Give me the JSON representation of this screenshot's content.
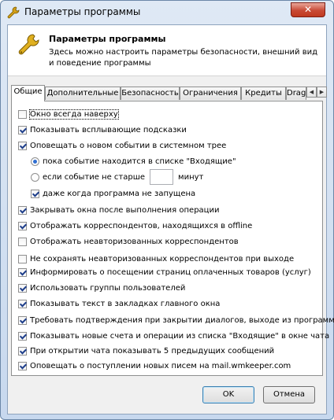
{
  "window": {
    "title": "Параметры программы",
    "close_symbol": "✕"
  },
  "header": {
    "title": "Параметры программы",
    "description": "Здесь можно настроить параметры безопасности, внешний вид и поведение программы",
    "icon": "wrench-icon"
  },
  "tabs": [
    {
      "label": "Общие",
      "active": true
    },
    {
      "label": "Дополнительные",
      "active": false
    },
    {
      "label": "Безопасность",
      "active": false
    },
    {
      "label": "Ограничения",
      "active": false
    },
    {
      "label": "Кредиты",
      "active": false
    },
    {
      "label": "Drag",
      "active": false
    }
  ],
  "tab_scroll": {
    "left": "◀",
    "right": "▶"
  },
  "options": {
    "always_on_top": {
      "label": "Окно всегда наверху",
      "checked": false
    },
    "show_tooltips": {
      "label": "Показывать всплывающие подсказки",
      "checked": true
    },
    "notify_tray": {
      "label": "Оповещать о новом событии в системном трее",
      "checked": true
    },
    "radio_inbox": {
      "label": "пока событие находится в списке \"Входящие\"",
      "checked": true
    },
    "radio_not_older_prefix": {
      "label": "если событие не старше",
      "checked": false
    },
    "minutes_value": "",
    "minutes_suffix": "минут",
    "even_when_not_running": {
      "label": "даже когда программа не запущена",
      "checked": true
    },
    "close_after_op": {
      "label": "Закрывать окна после выполнения операции",
      "checked": true
    },
    "show_offline": {
      "label": "Отображать корреспондентов, находящихся в offline",
      "checked": true
    },
    "show_unauthorized": {
      "label": "Отображать неавторизованных корреспондентов",
      "checked": false
    },
    "dont_save_unauthorized": {
      "label": "Не сохранять неавторизованных корреспондентов при выходе",
      "checked": false
    },
    "inform_paid_pages": {
      "label": "Информировать о посещении страниц оплаченных товаров (услуг)",
      "checked": true
    },
    "use_user_groups": {
      "label": "Использовать группы пользователей",
      "checked": true
    },
    "show_text_tabs": {
      "label": "Показывать текст в закладках главного окна",
      "checked": true
    },
    "confirm_close": {
      "label": "Требовать подтверждения при закрытии диалогов, выходе из программы",
      "checked": true
    },
    "show_new_accounts": {
      "label": "Показывать новые счета и операции из списка \"Входящие\" в окне чата",
      "checked": true
    },
    "show_5_messages": {
      "label": "При открытии чата показывать 5 предыдущих сообщений",
      "checked": true
    },
    "notify_new_mail": {
      "label": "Оповещать о поступлении новых писем на mail.wmkeeper.com",
      "checked": true
    }
  },
  "buttons": {
    "ok": "OK",
    "cancel": "Отмена"
  }
}
